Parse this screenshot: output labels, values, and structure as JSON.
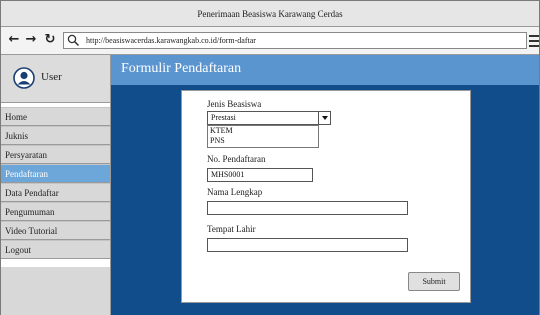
{
  "window": {
    "title": "Penerimaan Beasiswa Karawang Cerdas"
  },
  "toolbar": {
    "back_icon": "arrow-left-icon",
    "forward_icon": "arrow-right-icon",
    "reload_icon": "reload-icon",
    "search_icon": "search-icon",
    "url": "http://beasiswacerdas.karawangkab.co.id/form-daftar",
    "menu_icon": "hamburger-menu-icon"
  },
  "sidebar": {
    "user_icon": "user-avatar-icon",
    "user_label": "User",
    "items": [
      {
        "label": "Home"
      },
      {
        "label": "Juknis"
      },
      {
        "label": "Persyaratan"
      },
      {
        "label": "Pendaftaran",
        "active": true
      },
      {
        "label": "Data Pendaftar"
      },
      {
        "label": "Pengumuman"
      },
      {
        "label": "Video Tutorial"
      },
      {
        "label": "Logout"
      }
    ]
  },
  "main": {
    "title": "Formulir Pendaftaran",
    "form": {
      "jenis_label": "Jenis Beasiswa",
      "jenis_value": "Prestasi",
      "jenis_options": [
        "KTEM",
        "PNS"
      ],
      "no_label": "No. Pendaftaran",
      "no_value": "MHS0001",
      "nama_label": "Nama Lengkap",
      "nama_value": "",
      "tempat_label": "Tempat Lahir",
      "tempat_value": "",
      "submit_label": "Submit"
    }
  },
  "colors": {
    "header_blue": "#5b95d0",
    "background_navy": "#104d8a",
    "active_item": "#6da6d9"
  }
}
